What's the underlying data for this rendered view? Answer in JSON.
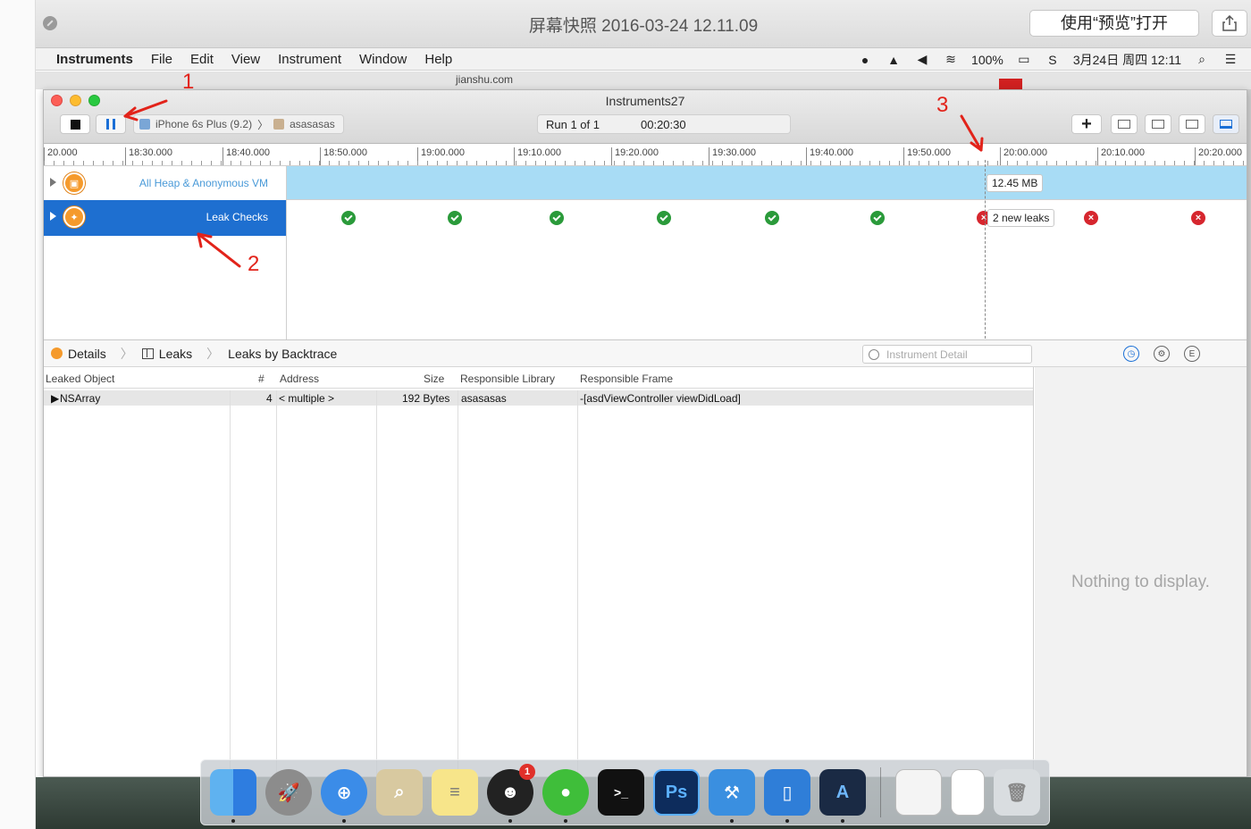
{
  "preview": {
    "title": "屏幕快照 2016-03-24 12.11.09",
    "open_button": "使用“预览”打开"
  },
  "menubar": {
    "app": "Instruments",
    "items": [
      "File",
      "Edit",
      "View",
      "Instrument",
      "Window",
      "Help"
    ],
    "battery": "100%",
    "datetime": "3月24日 周四  12:11"
  },
  "background_window": {
    "url": "jianshu.com"
  },
  "instruments": {
    "window_title": "Instruments27",
    "device": "iPhone 6s Plus (9.2)",
    "target_app": "asasasas",
    "run_label": "Run 1 of 1",
    "elapsed": "00:20:30",
    "ruler_ticks": [
      "20.000",
      "18:30.000",
      "18:40.000",
      "18:50.000",
      "19:00.000",
      "19:10.000",
      "19:20.000",
      "19:30.000",
      "19:40.000",
      "19:50.000",
      "20:00.000",
      "20:10.000",
      "20:20.000"
    ],
    "tracks": {
      "heap": {
        "name": "All Heap & Anonymous VM",
        "tooltip": "12.45 MB"
      },
      "leaks": {
        "name": "Leak Checks",
        "tooltip": "2 new leaks"
      }
    },
    "detail": {
      "crumbs": [
        "Details",
        "Leaks",
        "Leaks by Backtrace"
      ],
      "filter_placeholder": "Instrument Detail"
    },
    "table": {
      "columns": [
        "Leaked Object",
        "#",
        "Address",
        "Size",
        "Responsible Library",
        "Responsible Frame"
      ],
      "rows": [
        {
          "object": "NSArray",
          "count": "4",
          "address": "< multiple >",
          "size": "192 Bytes",
          "library": "asasasas",
          "frame": "-[asdViewController viewDidLoad]"
        }
      ]
    },
    "inspector_empty": "Nothing to display."
  },
  "annotations": [
    "1",
    "2",
    "3"
  ],
  "dock": {
    "qq_badge": "1",
    "ps_label": "Ps"
  }
}
